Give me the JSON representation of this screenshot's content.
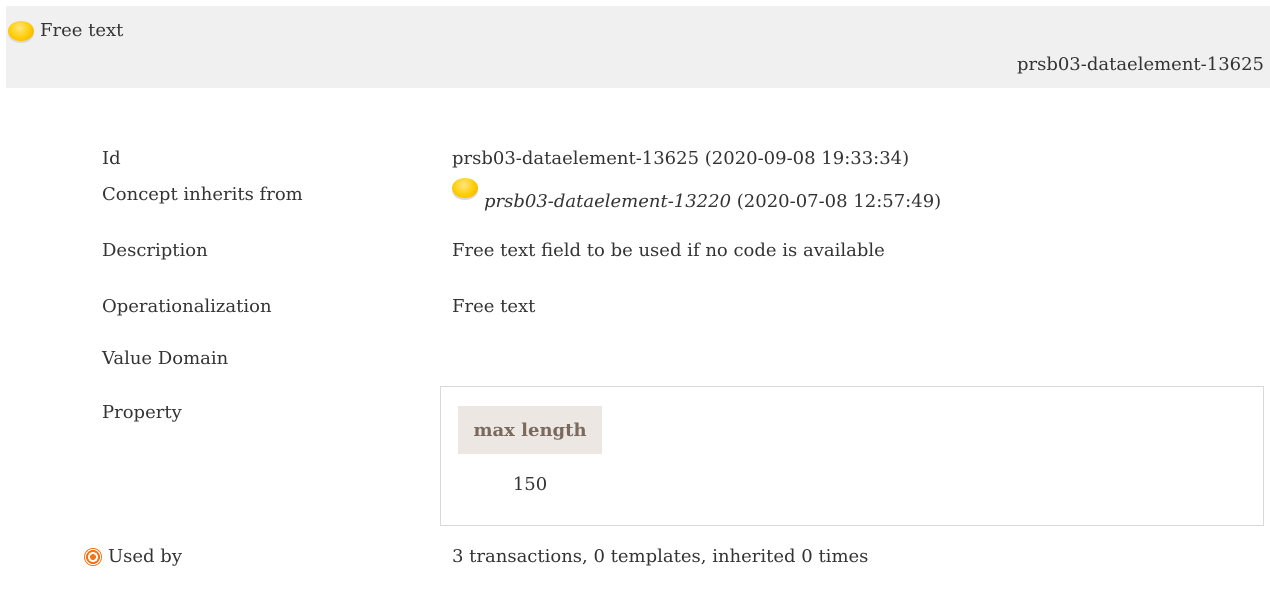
{
  "header": {
    "title": "Free text",
    "id": "prsb03-dataelement-13625",
    "icon": "yellow-orb-icon"
  },
  "rows": {
    "id": {
      "label": "Id",
      "value": "prsb03-dataelement-13625 (2020-09-08 19:33:34)"
    },
    "inherits": {
      "label": "Concept inherits from",
      "ref": "prsb03-dataelement-13220",
      "date": "(2020-07-08 12:57:49)",
      "icon": "yellow-orb-icon"
    },
    "description": {
      "label": "Description",
      "value": "Free text field to be used if no code is available"
    },
    "operationalization": {
      "label": "Operationalization",
      "value": "Free text"
    },
    "value_domain": {
      "label": "Value Domain"
    },
    "property": {
      "label": "Property",
      "header": "max length",
      "value": "150"
    },
    "used_by": {
      "label": "Used by",
      "value": "3 transactions, 0 templates, inherited 0 times",
      "icon": "target-icon"
    }
  },
  "colors": {
    "orb": "#ffcc00",
    "target": "#f97316",
    "header_bg": "#f0f0f0",
    "prop_head_bg": "#ede7e3",
    "prop_head_text": "#7a6a5e"
  }
}
